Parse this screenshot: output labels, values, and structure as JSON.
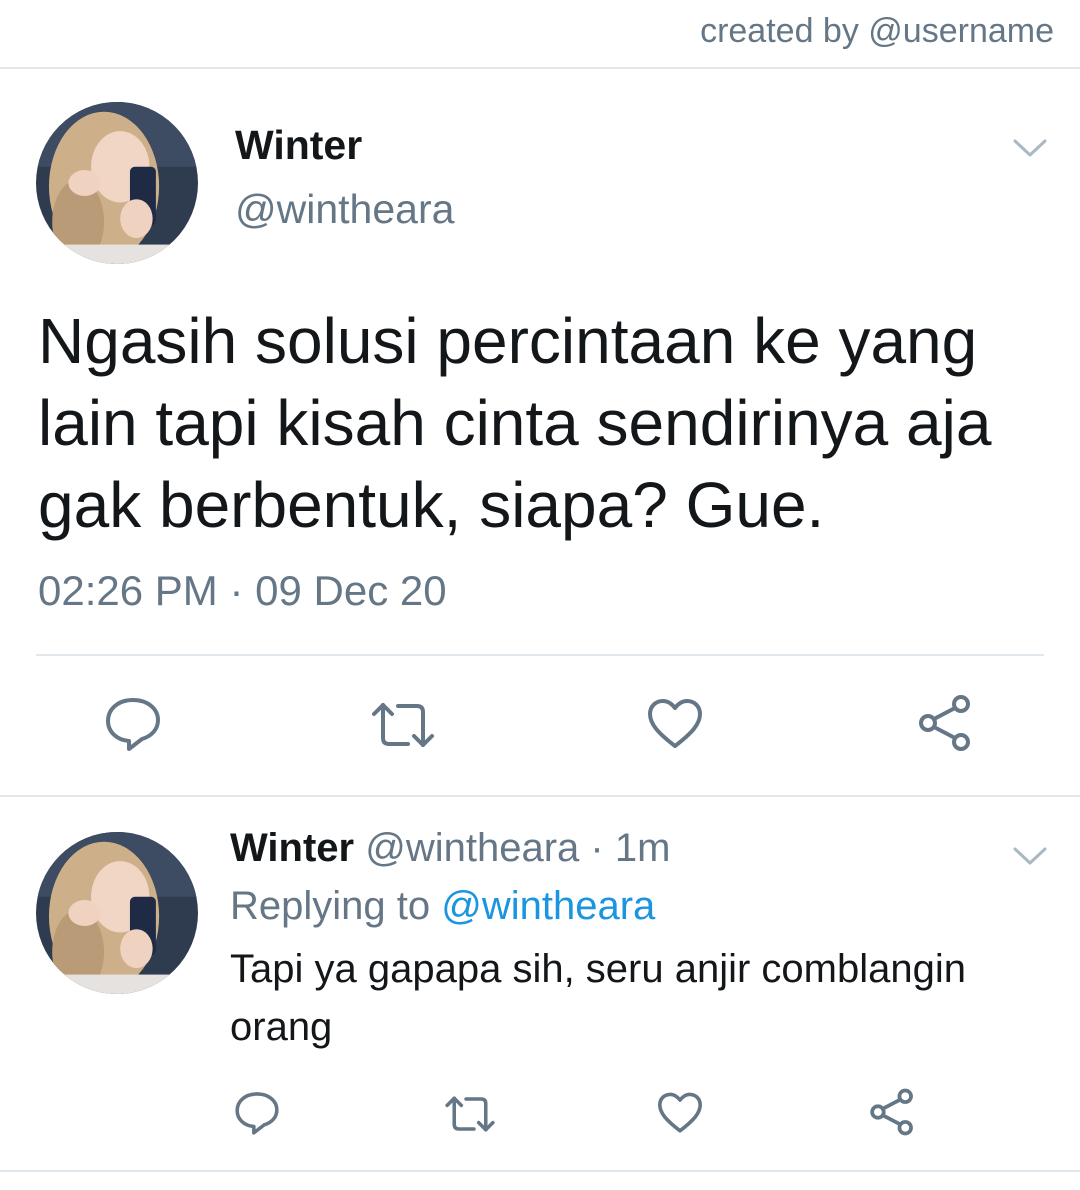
{
  "credit": "created by @username",
  "tweet": {
    "name": "Winter",
    "handle": "@wintheara",
    "text": "Ngasih solusi percintaan ke yang lain tapi kisah cinta sendirinya aja gak berbentuk, siapa? Gue.",
    "time": "02:26 PM",
    "dot": "·",
    "date": "09 Dec 20"
  },
  "reply": {
    "name": "Winter",
    "handle": "@wintheara",
    "dot": "·",
    "age": "1m",
    "replying_label": "Replying to",
    "replying_handle": "@wintheara",
    "text": "Tapi ya gapapa sih, seru anjir comblangin orang"
  },
  "icons": {
    "reply": "comment-icon",
    "retweet": "retweet-icon",
    "like": "heart-icon",
    "share": "share-icon",
    "menu": "chevron-down-icon"
  },
  "colors": {
    "text": "#14171a",
    "secondary": "#657786",
    "link": "#1b95e0",
    "divider": "#e1e8ed"
  }
}
